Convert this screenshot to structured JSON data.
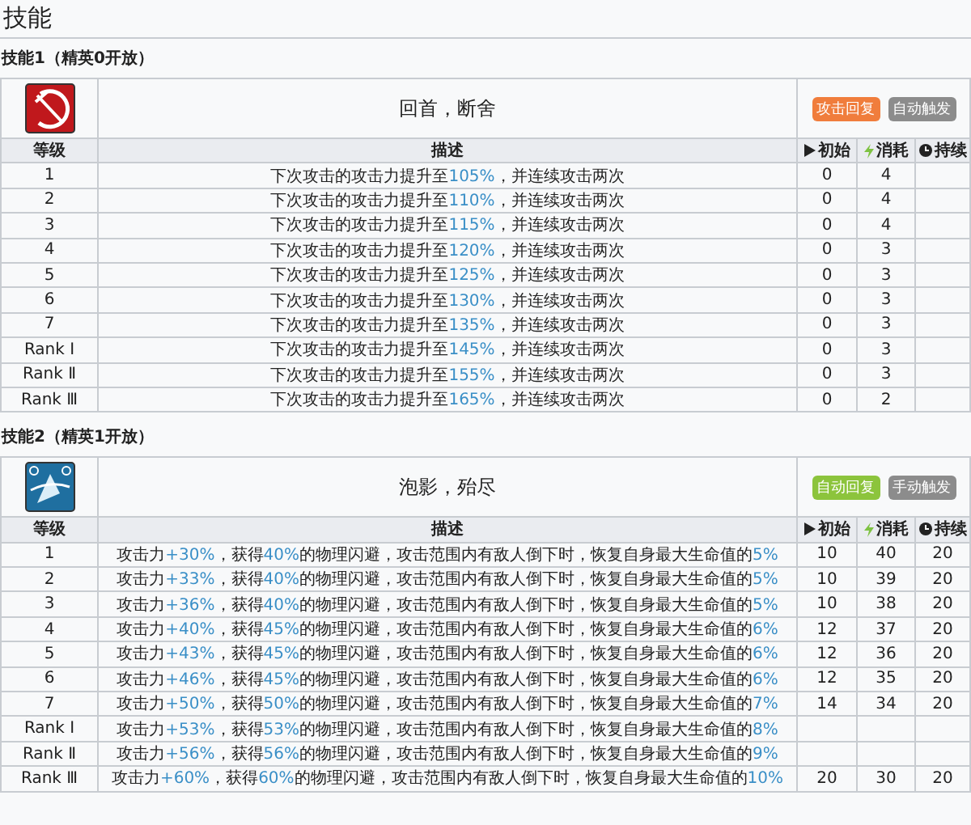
{
  "title": "技能",
  "skills": [
    {
      "heading": "技能1（精英0开放）",
      "columns": {
        "level": "等级",
        "desc": "描述",
        "init": "初始",
        "cost": "消耗",
        "dur": "持续"
      },
      "name": "回首，断舍",
      "tags": [
        {
          "text": "攻击回复",
          "color": "#f07d3c"
        },
        {
          "text": "自动触发",
          "color": "#8c8c8c"
        }
      ],
      "rows": [
        {
          "level": "1",
          "desc": [
            {
              "kind": "plain",
              "text": "下次攻击的攻击力提升至"
            },
            {
              "kind": "value",
              "text": "105%"
            },
            {
              "kind": "plain",
              "text": "，并连续攻击两次"
            }
          ],
          "init": "0",
          "cost": "4",
          "dur": null
        },
        {
          "level": "2",
          "desc": [
            {
              "kind": "plain",
              "text": "下次攻击的攻击力提升至"
            },
            {
              "kind": "value",
              "text": "110%"
            },
            {
              "kind": "plain",
              "text": "，并连续攻击两次"
            }
          ],
          "init": "0",
          "cost": "4",
          "dur": null
        },
        {
          "level": "3",
          "desc": [
            {
              "kind": "plain",
              "text": "下次攻击的攻击力提升至"
            },
            {
              "kind": "value",
              "text": "115%"
            },
            {
              "kind": "plain",
              "text": "，并连续攻击两次"
            }
          ],
          "init": "0",
          "cost": "4",
          "dur": null
        },
        {
          "level": "4",
          "desc": [
            {
              "kind": "plain",
              "text": "下次攻击的攻击力提升至"
            },
            {
              "kind": "value",
              "text": "120%"
            },
            {
              "kind": "plain",
              "text": "，并连续攻击两次"
            }
          ],
          "init": "0",
          "cost": "3",
          "dur": null
        },
        {
          "level": "5",
          "desc": [
            {
              "kind": "plain",
              "text": "下次攻击的攻击力提升至"
            },
            {
              "kind": "value",
              "text": "125%"
            },
            {
              "kind": "plain",
              "text": "，并连续攻击两次"
            }
          ],
          "init": "0",
          "cost": "3",
          "dur": null
        },
        {
          "level": "6",
          "desc": [
            {
              "kind": "plain",
              "text": "下次攻击的攻击力提升至"
            },
            {
              "kind": "value",
              "text": "130%"
            },
            {
              "kind": "plain",
              "text": "，并连续攻击两次"
            }
          ],
          "init": "0",
          "cost": "3",
          "dur": null
        },
        {
          "level": "7",
          "desc": [
            {
              "kind": "plain",
              "text": "下次攻击的攻击力提升至"
            },
            {
              "kind": "value",
              "text": "135%"
            },
            {
              "kind": "plain",
              "text": "，并连续攻击两次"
            }
          ],
          "init": "0",
          "cost": "3",
          "dur": null
        },
        {
          "level": "Rank Ⅰ",
          "desc": [
            {
              "kind": "plain",
              "text": "下次攻击的攻击力提升至"
            },
            {
              "kind": "value",
              "text": "145%"
            },
            {
              "kind": "plain",
              "text": "，并连续攻击两次"
            }
          ],
          "init": "0",
          "cost": "3",
          "dur": null
        },
        {
          "level": "Rank Ⅱ",
          "desc": [
            {
              "kind": "plain",
              "text": "下次攻击的攻击力提升至"
            },
            {
              "kind": "value",
              "text": "155%"
            },
            {
              "kind": "plain",
              "text": "，并连续攻击两次"
            }
          ],
          "init": "0",
          "cost": "3",
          "dur": null
        },
        {
          "level": "Rank Ⅲ",
          "desc": [
            {
              "kind": "plain",
              "text": "下次攻击的攻击力提升至"
            },
            {
              "kind": "value",
              "text": "165%"
            },
            {
              "kind": "plain",
              "text": "，并连续攻击两次"
            }
          ],
          "init": "0",
          "cost": "2",
          "dur": null
        }
      ]
    },
    {
      "heading": "技能2（精英1开放）",
      "columns": {
        "level": "等级",
        "desc": "描述",
        "init": "初始",
        "cost": "消耗",
        "dur": "持续"
      },
      "name": "泡影，殆尽",
      "tags": [
        {
          "text": "自动回复",
          "color": "#8cc43c"
        },
        {
          "text": "手动触发",
          "color": "#8c8c8c"
        }
      ],
      "rows": [
        {
          "level": "1",
          "desc": [
            {
              "kind": "plain",
              "text": "攻击力"
            },
            {
              "kind": "value",
              "text": "+30%"
            },
            {
              "kind": "plain",
              "text": "，获得"
            },
            {
              "kind": "value",
              "text": "40%"
            },
            {
              "kind": "plain",
              "text": "的物理闪避，攻击范围内有敌人倒下时，恢复自身最大生命值的"
            },
            {
              "kind": "value",
              "text": "5%"
            }
          ],
          "init": "10",
          "cost": "40",
          "dur": "20"
        },
        {
          "level": "2",
          "desc": [
            {
              "kind": "plain",
              "text": "攻击力"
            },
            {
              "kind": "value",
              "text": "+33%"
            },
            {
              "kind": "plain",
              "text": "，获得"
            },
            {
              "kind": "value",
              "text": "40%"
            },
            {
              "kind": "plain",
              "text": "的物理闪避，攻击范围内有敌人倒下时，恢复自身最大生命值的"
            },
            {
              "kind": "value",
              "text": "5%"
            }
          ],
          "init": "10",
          "cost": "39",
          "dur": "20"
        },
        {
          "level": "3",
          "desc": [
            {
              "kind": "plain",
              "text": "攻击力"
            },
            {
              "kind": "value",
              "text": "+36%"
            },
            {
              "kind": "plain",
              "text": "，获得"
            },
            {
              "kind": "value",
              "text": "40%"
            },
            {
              "kind": "plain",
              "text": "的物理闪避，攻击范围内有敌人倒下时，恢复自身最大生命值的"
            },
            {
              "kind": "value",
              "text": "5%"
            }
          ],
          "init": "10",
          "cost": "38",
          "dur": "20"
        },
        {
          "level": "4",
          "desc": [
            {
              "kind": "plain",
              "text": "攻击力"
            },
            {
              "kind": "value",
              "text": "+40%"
            },
            {
              "kind": "plain",
              "text": "，获得"
            },
            {
              "kind": "value",
              "text": "45%"
            },
            {
              "kind": "plain",
              "text": "的物理闪避，攻击范围内有敌人倒下时，恢复自身最大生命值的"
            },
            {
              "kind": "value",
              "text": "6%"
            }
          ],
          "init": "12",
          "cost": "37",
          "dur": "20"
        },
        {
          "level": "5",
          "desc": [
            {
              "kind": "plain",
              "text": "攻击力"
            },
            {
              "kind": "value",
              "text": "+43%"
            },
            {
              "kind": "plain",
              "text": "，获得"
            },
            {
              "kind": "value",
              "text": "45%"
            },
            {
              "kind": "plain",
              "text": "的物理闪避，攻击范围内有敌人倒下时，恢复自身最大生命值的"
            },
            {
              "kind": "value",
              "text": "6%"
            }
          ],
          "init": "12",
          "cost": "36",
          "dur": "20"
        },
        {
          "level": "6",
          "desc": [
            {
              "kind": "plain",
              "text": "攻击力"
            },
            {
              "kind": "value",
              "text": "+46%"
            },
            {
              "kind": "plain",
              "text": "，获得"
            },
            {
              "kind": "value",
              "text": "45%"
            },
            {
              "kind": "plain",
              "text": "的物理闪避，攻击范围内有敌人倒下时，恢复自身最大生命值的"
            },
            {
              "kind": "value",
              "text": "6%"
            }
          ],
          "init": "12",
          "cost": "35",
          "dur": "20"
        },
        {
          "level": "7",
          "desc": [
            {
              "kind": "plain",
              "text": "攻击力"
            },
            {
              "kind": "value",
              "text": "+50%"
            },
            {
              "kind": "plain",
              "text": "，获得"
            },
            {
              "kind": "value",
              "text": "50%"
            },
            {
              "kind": "plain",
              "text": "的物理闪避，攻击范围内有敌人倒下时，恢复自身最大生命值的"
            },
            {
              "kind": "value",
              "text": "7%"
            }
          ],
          "init": "14",
          "cost": "34",
          "dur": "20"
        },
        {
          "level": "Rank Ⅰ",
          "desc": [
            {
              "kind": "plain",
              "text": "攻击力"
            },
            {
              "kind": "value",
              "text": "+53%"
            },
            {
              "kind": "plain",
              "text": "，获得"
            },
            {
              "kind": "value",
              "text": "53%"
            },
            {
              "kind": "plain",
              "text": "的物理闪避，攻击范围内有敌人倒下时，恢复自身最大生命值的"
            },
            {
              "kind": "value",
              "text": "8%"
            }
          ],
          "init": null,
          "cost": null,
          "dur": null
        },
        {
          "level": "Rank Ⅱ",
          "desc": [
            {
              "kind": "plain",
              "text": "攻击力"
            },
            {
              "kind": "value",
              "text": "+56%"
            },
            {
              "kind": "plain",
              "text": "，获得"
            },
            {
              "kind": "value",
              "text": "56%"
            },
            {
              "kind": "plain",
              "text": "的物理闪避，攻击范围内有敌人倒下时，恢复自身最大生命值的"
            },
            {
              "kind": "value",
              "text": "9%"
            }
          ],
          "init": null,
          "cost": null,
          "dur": null
        },
        {
          "level": "Rank Ⅲ",
          "desc": [
            {
              "kind": "plain",
              "text": "攻击力"
            },
            {
              "kind": "value",
              "text": "+60%"
            },
            {
              "kind": "plain",
              "text": "，获得"
            },
            {
              "kind": "value",
              "text": "60%"
            },
            {
              "kind": "plain",
              "text": "的物理闪避，攻击范围内有敌人倒下时，恢复自身最大生命值的"
            },
            {
              "kind": "value",
              "text": "10%"
            }
          ],
          "init": "20",
          "cost": "30",
          "dur": "20"
        }
      ]
    }
  ]
}
